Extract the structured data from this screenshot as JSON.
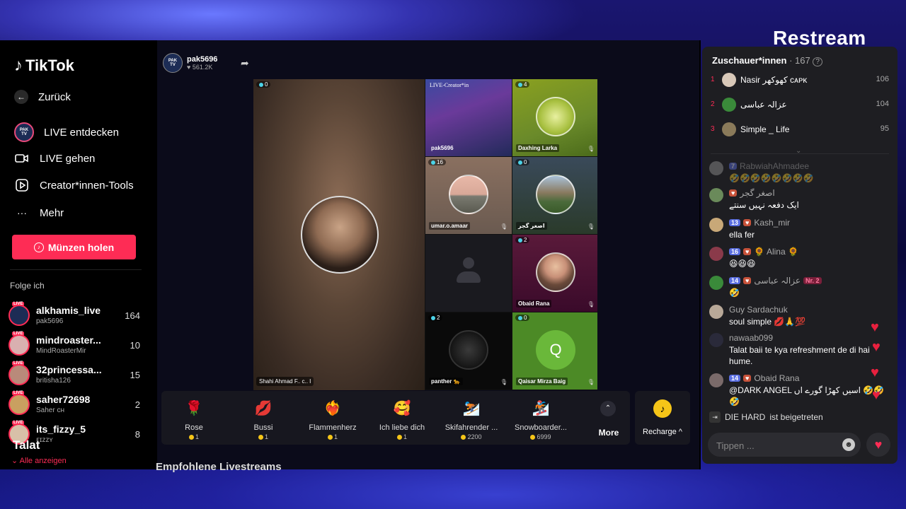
{
  "overlay": {
    "brand": "Restream"
  },
  "sidebar": {
    "logo": "TikTok",
    "nav": [
      {
        "label": "Zurück",
        "icon": "arrow-left-icon"
      },
      {
        "label": "LIVE entdecken",
        "icon": "pak-tv-avatar"
      },
      {
        "label": "LIVE gehen",
        "icon": "camera-icon"
      },
      {
        "label": "Creator*innen-Tools",
        "icon": "play-icon"
      },
      {
        "label": "Mehr",
        "icon": "more-icon"
      }
    ],
    "coins_button": "Münzen holen",
    "following_title": "Folge ich",
    "following": [
      {
        "name": "alkhamis_live",
        "sub": "pak5696",
        "count": "164"
      },
      {
        "name": "mindroaster...",
        "sub": "MindRoasterMir",
        "count": "10"
      },
      {
        "name": "32princessa...",
        "sub": "britisha126",
        "count": "15"
      },
      {
        "name": "saher72698",
        "sub": "Saher ᴄʜ",
        "count": "2"
      },
      {
        "name": "its_fizzy_5",
        "sub": "ꜰɪᴢᴢʏ",
        "count": "8"
      }
    ],
    "overlay_name": "Talat",
    "show_all": "Alle anzeigen",
    "live_tag": "LIVE"
  },
  "stream": {
    "streamer": "pak5696",
    "likes": "561.2K",
    "host_name": "Shahi Ahmad F.. c.. I",
    "host_badge": "0",
    "guests": [
      {
        "name": "pak5696",
        "badge": "",
        "title": "LIVE-Creator*in"
      },
      {
        "name": "Daxhing Larka",
        "badge": "4"
      },
      {
        "name": "umar.o.amaar",
        "badge": "16"
      },
      {
        "name": "اصغر گجر",
        "badge": "0"
      },
      {
        "name": "",
        "badge": ""
      },
      {
        "name": "Obaid Rana",
        "badge": "2"
      },
      {
        "name": "panther 🐆",
        "badge": "2"
      },
      {
        "name": "Qaisar Mirza Baig",
        "badge": "0",
        "initial": "Q"
      }
    ]
  },
  "gifts": [
    {
      "name": "Rose",
      "price": "1",
      "emoji": "🌹"
    },
    {
      "name": "Bussi",
      "price": "1",
      "emoji": "💋"
    },
    {
      "name": "Flammenherz",
      "price": "1",
      "emoji": "❤️‍🔥"
    },
    {
      "name": "Ich liebe dich",
      "price": "1",
      "emoji": "🥰"
    },
    {
      "name": "Skifahrender ...",
      "price": "2200",
      "emoji": "⛷️"
    },
    {
      "name": "Snowboarder...",
      "price": "6999",
      "emoji": "🏂"
    }
  ],
  "more_label": "More",
  "recharge_label": "Recharge ^",
  "recommended_title": "Empfohlene Livestreams",
  "panel": {
    "viewers_title": "Zuschauer*innen",
    "viewers_count": "· 167",
    "ranking": [
      {
        "rank": "1",
        "name": "Nasir کھوکھر ᴄᴀᴘᴋ",
        "score": "106"
      },
      {
        "rank": "2",
        "name": "عزالہ عباسی",
        "score": "104"
      },
      {
        "rank": "3",
        "name": "Simple _ Life",
        "score": "95"
      }
    ],
    "messages": [
      {
        "level": "7",
        "user": "RabwiahAhmadee",
        "text": "🤣🤣🤣🤣🤣🤣🤣🤣"
      },
      {
        "level": "",
        "user": "اصغر گجر",
        "text": "ایک دفعہ نہیں سنتے"
      },
      {
        "level": "13",
        "user": "Kash_mir",
        "text": "ella fer"
      },
      {
        "level": "16",
        "user": "🌻 Alina 🌻",
        "text": "😆😆😆"
      },
      {
        "level": "14",
        "user": "عزالہ عباسی",
        "badge": "Nr. 2",
        "text": "🤣"
      },
      {
        "level": "",
        "user": "Guy Sardachuk",
        "text": "soul simple 💋🙏💯"
      },
      {
        "level": "",
        "user": "nawaab099",
        "text": "Talat baii te kya refreshment de di hai hume."
      },
      {
        "level": "14",
        "user": "Obaid Rana",
        "text": "@DARK ANGEL اسیں کھڑا گورے اں 🤣🤣🤣"
      }
    ],
    "joined_user": "DIE HARD",
    "joined_text": "ist beigetreten",
    "input_placeholder": "Tippen ..."
  }
}
